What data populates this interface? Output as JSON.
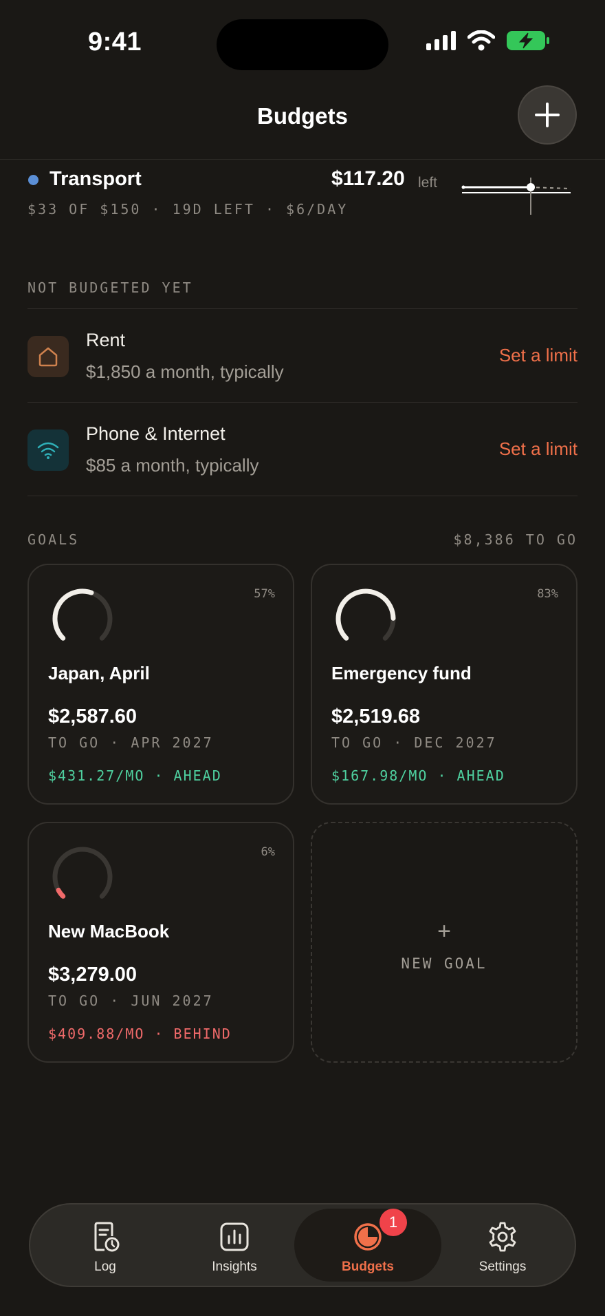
{
  "status": {
    "time": "9:41"
  },
  "header": {
    "title": "Budgets",
    "add_label": "+"
  },
  "transport": {
    "name": "Transport",
    "amount": "$117.20",
    "left_label": "left",
    "meta": "$33 OF $150 · 19D LEFT · $6/DAY",
    "color": "#5b8fd6"
  },
  "not_budgeted": {
    "label": "NOT BUDGETED YET",
    "items": [
      {
        "name": "Rent",
        "desc": "$1,850 a month, typically",
        "action": "Set a limit",
        "icon": "house-icon"
      },
      {
        "name": "Phone & Internet",
        "desc": "$85 a month, typically",
        "action": "Set a limit",
        "icon": "wifi-icon"
      }
    ]
  },
  "goals": {
    "label": "GOALS",
    "summary": "$8,386 TO GO",
    "items": [
      {
        "name": "Japan, April",
        "pct": "57%",
        "progress": 0.57,
        "amount": "$2,587.60",
        "due": "TO GO · APR 2027",
        "pace": "$431.27/MO · AHEAD",
        "status": "ahead"
      },
      {
        "name": "Emergency fund",
        "pct": "83%",
        "progress": 0.83,
        "amount": "$2,519.68",
        "due": "TO GO · DEC 2027",
        "pace": "$167.98/MO · AHEAD",
        "status": "ahead"
      },
      {
        "name": "New MacBook",
        "pct": "6%",
        "progress": 0.06,
        "amount": "$3,279.00",
        "due": "TO GO · JUN 2027",
        "pace": "$409.88/MO · BEHIND",
        "status": "behind"
      }
    ],
    "new_goal_plus": "+",
    "new_goal_label": "NEW GOAL"
  },
  "tabs": [
    {
      "label": "Log",
      "icon": "receipt-clock-icon"
    },
    {
      "label": "Insights",
      "icon": "bar-chart-icon"
    },
    {
      "label": "Budgets",
      "icon": "pie-icon",
      "active": true,
      "badge": "1"
    },
    {
      "label": "Settings",
      "icon": "gear-icon"
    }
  ],
  "colors": {
    "accent": "#f0704a",
    "ahead": "#4fd1a0",
    "behind": "#f06a6a",
    "battery": "#34c759"
  }
}
